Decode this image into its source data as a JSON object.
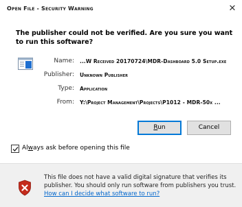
{
  "window": {
    "title": "Open File - Security Warning"
  },
  "message": {
    "question": "The publisher could not be verified.  Are you sure you want to run this software?"
  },
  "details": {
    "name_label": "Name:",
    "name_value": "...W Received 20170724\\MDR-Dashboard 5.0 Setup.exe",
    "publisher_label": "Publisher:",
    "publisher_value": "Unknown Publisher",
    "type_label": "Type:",
    "type_value": "Application",
    "from_label": "From:",
    "from_value": "Y:\\Project Management\\Projects\\P1012 - MDR-50x ..."
  },
  "buttons": {
    "run_label": "Run",
    "run_mnemonic": "R",
    "run_rest": "un",
    "cancel_label": "Cancel"
  },
  "checkbox": {
    "label": "Always ask before opening this file",
    "label_pre": "Al",
    "label_mnemonic": "w",
    "label_post": "ays ask before opening this file",
    "checked": true
  },
  "warning": {
    "text": "This file does not have a valid digital signature that verifies its publisher.  You should only run software from publishers you trust.",
    "link_text": "How can I decide what software to run?"
  },
  "colors": {
    "link": "#0066cc",
    "default_button_border": "#0078d7",
    "panel_background": "#f0f0f0",
    "shield_red": "#c42b1c"
  },
  "icons": {
    "close": "close-icon",
    "app": "application-icon",
    "shield": "security-shield-icon",
    "check": "checkmark-icon"
  }
}
